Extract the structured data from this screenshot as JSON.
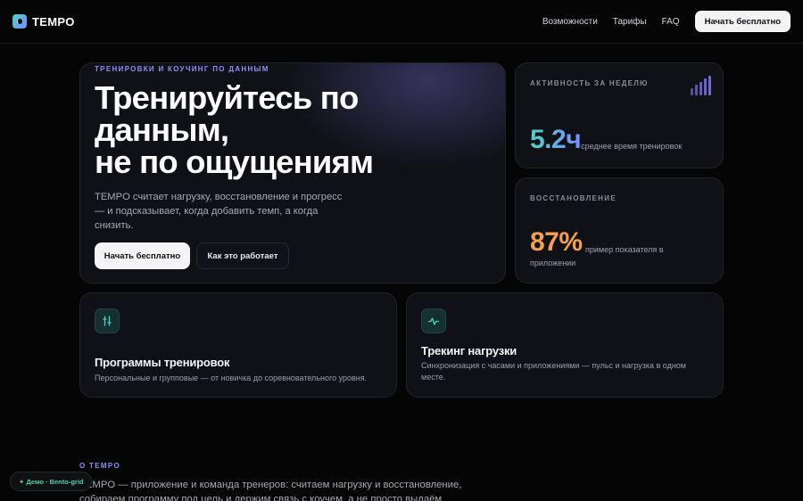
{
  "header": {
    "brand": "TEMPO",
    "nav": [
      "Возможности",
      "Тарифы",
      "FAQ"
    ],
    "cta": "Начать бесплатно"
  },
  "hero": {
    "eyebrow": "ТРЕНИРОВКИ И КОУЧИНГ ПО ДАННЫМ",
    "title_lines": [
      "Тренируйтесь по",
      "данным,",
      "не по ощущениям"
    ],
    "description": "TEMPO считает нагрузку, восстановление и прогресс — и подсказывает, когда добавить темп, а когда снизить.",
    "primary_button": "Начать бесплатно",
    "secondary_button": "Как это работает"
  },
  "stats": [
    {
      "label": "АКТИВНОСТЬ ЗА НЕДЕЛЮ",
      "value": "5.2ч",
      "note": "среднее время тренировок",
      "icon": "bar-chart-icon",
      "bar_levels": [
        0.35,
        0.55,
        0.7,
        0.85,
        1.0
      ]
    },
    {
      "label": "ВОССТАНОВЛЕНИЕ",
      "value": "87%",
      "note": "пример показателя в приложении"
    }
  ],
  "features": [
    {
      "icon": "sliders-icon",
      "title": "Программы тренировок",
      "description": "Персональные и групповые — от новичка до соревновательного уровня."
    },
    {
      "icon": "pulse-icon",
      "title": "Трекинг нагрузки",
      "description": "Синхронизация с часами и приложениями — пульс и нагрузка в одном месте."
    }
  ],
  "about": {
    "eyebrow": "О TEMPO",
    "text": "TEMPO — приложение и команда тренеров: считаем нагрузку и восстановление, собираем программу под цель и держим связь с коучем, а не просто выдаём список"
  },
  "demo_badge": "✦ Демо · Bento-grid",
  "colors": {
    "accent_purple": "#8b8ff5",
    "accent_teal": "#4fd1c5",
    "accent_orange": "#f5a04a",
    "background": "#050506"
  }
}
